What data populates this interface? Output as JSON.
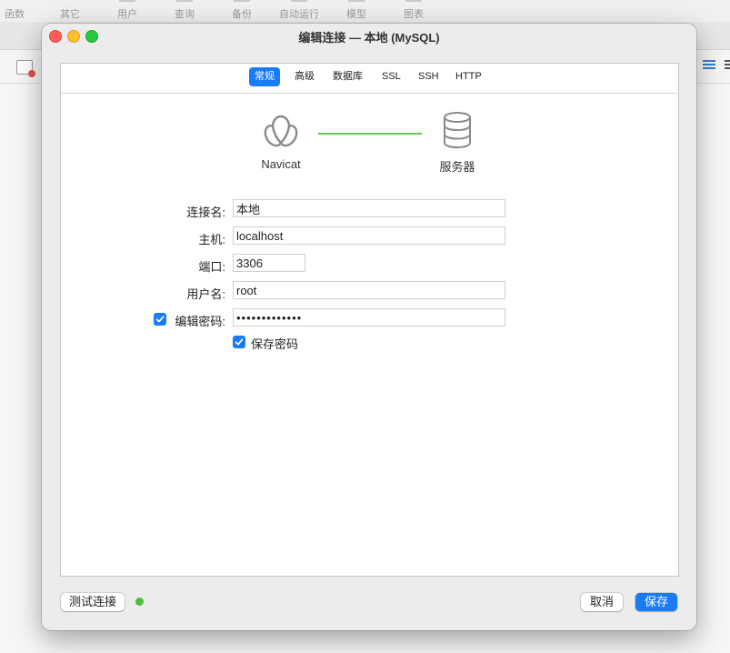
{
  "background_app": {
    "toolbar_items": [
      "函数",
      "其它",
      "用户",
      "查询",
      "备份",
      "自动运行",
      "模型",
      "图表"
    ]
  },
  "dialog": {
    "title": "编辑连接 — 本地 (MySQL)",
    "tabs": [
      {
        "label": "常规",
        "active": true
      },
      {
        "label": "高级",
        "active": false
      },
      {
        "label": "数据库",
        "active": false
      },
      {
        "label": "SSL",
        "active": false
      },
      {
        "label": "SSH",
        "active": false
      },
      {
        "label": "HTTP",
        "active": false
      }
    ],
    "diagram": {
      "left_label": "Navicat",
      "right_label": "服务器",
      "left_icon": "navicat-logo-icon",
      "right_icon": "database-server-icon",
      "link_color": "#62c554"
    },
    "form": {
      "connection_name": {
        "label": "连接名:",
        "value": "本地"
      },
      "host": {
        "label": "主机:",
        "value": "localhost"
      },
      "port": {
        "label": "端口:",
        "value": "3306"
      },
      "username": {
        "label": "用户名:",
        "value": "root"
      },
      "password": {
        "label": "编辑密码:",
        "value": "•••••••••••••",
        "edit_checked": true
      },
      "save_password": {
        "label": "保存密码",
        "checked": true
      }
    },
    "footer": {
      "test_button": "测试连接",
      "status_color": "#4bbf3a",
      "cancel_button": "取消",
      "save_button": "保存"
    },
    "accent_color": "#1a7cf5"
  }
}
